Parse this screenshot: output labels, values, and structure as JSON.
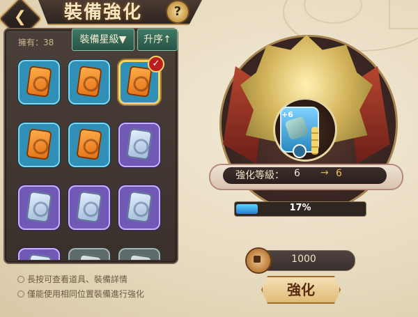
{
  "header": {
    "title": "裝備強化",
    "back_icon": "back-icon",
    "help_label": "?"
  },
  "inventory": {
    "owned_text": "擁有：38",
    "sort_label": "裝備星級▼",
    "order_label": "升序↑"
  },
  "hints": [
    "長按可查看道具、裝備詳情",
    "僅能使用相同位置裝備進行強化"
  ],
  "enhance": {
    "level_label": "強化等級：",
    "level_current": "6",
    "level_arrow": "→",
    "level_next": "6",
    "item_plus": "+6",
    "progress_text": "17%",
    "progress_value": 0.17,
    "cost_value": "1000",
    "button_label": "強化"
  },
  "colors": {
    "accent_green": "#3f7a63",
    "progress_blue": "#2a7bd3",
    "selected_gold": "#f5d46a"
  }
}
